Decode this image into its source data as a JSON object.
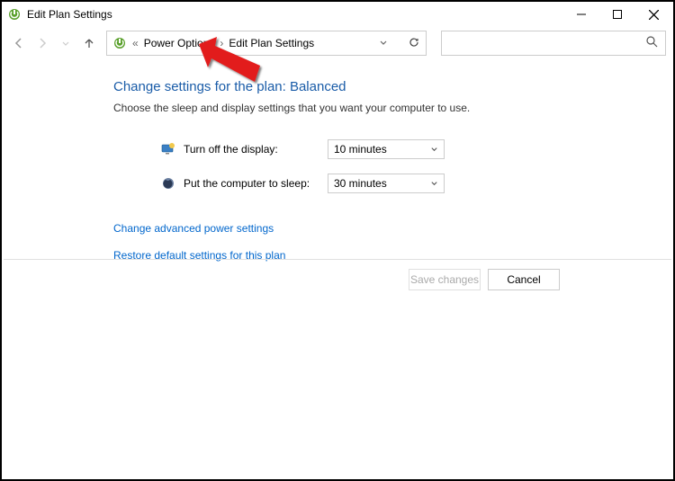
{
  "window": {
    "title": "Edit Plan Settings"
  },
  "breadcrumb": {
    "parent": "Power Options",
    "current": "Edit Plan Settings"
  },
  "content": {
    "heading": "Change settings for the plan: Balanced",
    "description": "Choose the sleep and display settings that you want your computer to use.",
    "settings": {
      "display_label": "Turn off the display:",
      "display_value": "10 minutes",
      "sleep_label": "Put the computer to sleep:",
      "sleep_value": "30 minutes"
    },
    "links": {
      "advanced": "Change advanced power settings",
      "restore": "Restore default settings for this plan"
    }
  },
  "footer": {
    "save": "Save changes",
    "cancel": "Cancel"
  }
}
